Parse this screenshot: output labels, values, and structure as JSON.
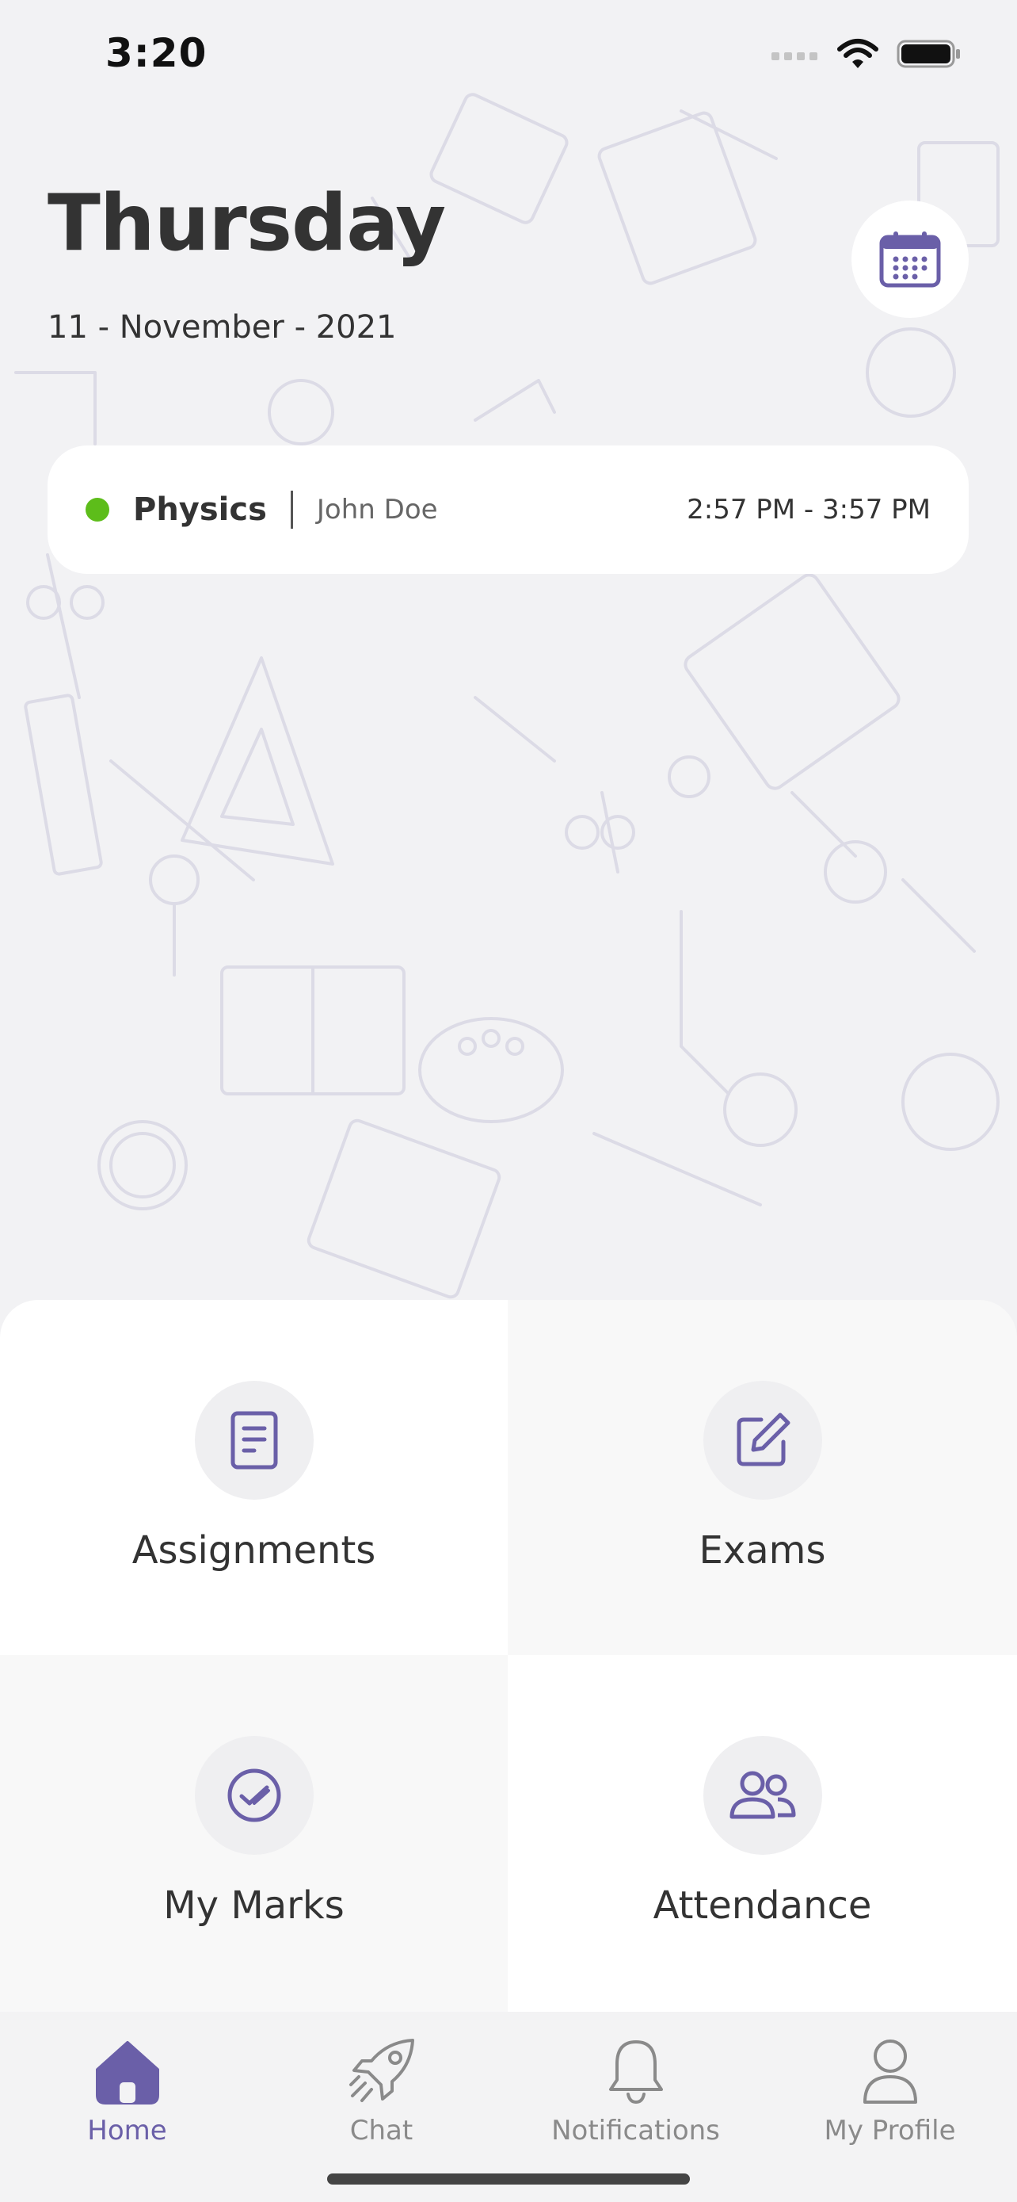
{
  "status_bar": {
    "time": "3:20"
  },
  "header": {
    "day": "Thursday",
    "date": "11 - November - 2021",
    "calendar_button_icon": "calendar-icon"
  },
  "class_card": {
    "status_color": "#5dbd1a",
    "subject": "Physics",
    "teacher": "John Doe",
    "time_range": "2:57 PM - 3:57 PM"
  },
  "tiles": [
    {
      "label": "Assignments",
      "icon": "document-icon"
    },
    {
      "label": "Exams",
      "icon": "edit-icon"
    },
    {
      "label": "My Marks",
      "icon": "check-circle-icon"
    },
    {
      "label": "Attendance",
      "icon": "users-icon"
    }
  ],
  "tab_bar": {
    "items": [
      {
        "label": "Home",
        "icon": "home-icon",
        "active": true
      },
      {
        "label": "Chat",
        "icon": "rocket-icon",
        "active": false
      },
      {
        "label": "Notifications",
        "icon": "bell-icon",
        "active": false
      },
      {
        "label": "My Profile",
        "icon": "person-icon",
        "active": false
      }
    ]
  },
  "colors": {
    "accent": "#6a5fa8",
    "background": "#f2f2f4",
    "inactive_tab": "#8a8a8a"
  }
}
